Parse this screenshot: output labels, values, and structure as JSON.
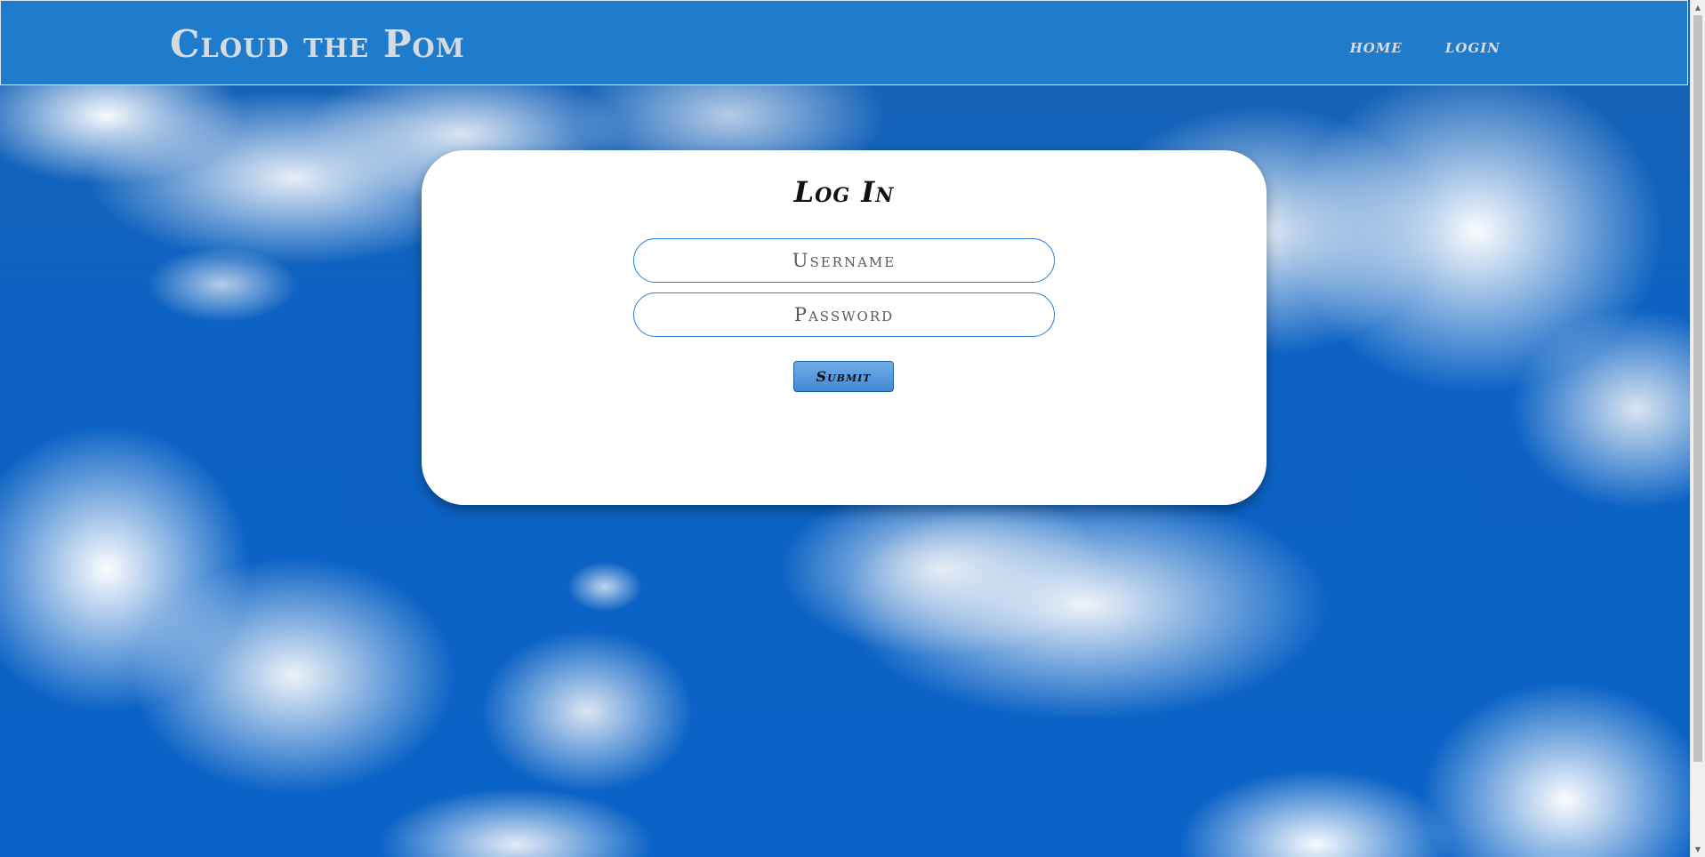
{
  "header": {
    "brand": "Cloud the Pom",
    "nav": [
      {
        "label": "home"
      },
      {
        "label": "login"
      }
    ]
  },
  "login": {
    "title": "Log In",
    "username_placeholder": "Username",
    "password_placeholder": "Password",
    "submit_label": "Submit"
  },
  "colors": {
    "navbar": "#1f7bcb",
    "button_top": "#72adea",
    "button_bottom": "#3f8ad6",
    "field_border": "#2a7fcf",
    "sky": "#0a63c6"
  }
}
